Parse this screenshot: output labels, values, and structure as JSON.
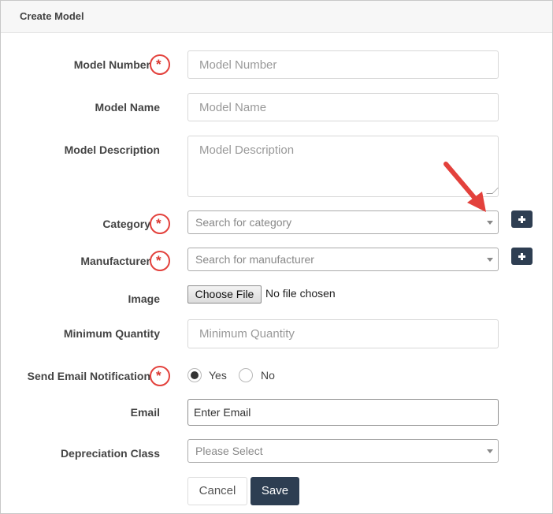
{
  "header": {
    "title": "Create Model"
  },
  "fields": {
    "model_number": {
      "label": "Model Number",
      "required": "*",
      "placeholder": "Model Number"
    },
    "model_name": {
      "label": "Model Name",
      "placeholder": "Model Name"
    },
    "model_description": {
      "label": "Model Description",
      "placeholder": "Model Description"
    },
    "category": {
      "label": "Category",
      "required": "*",
      "placeholder": "Search for category"
    },
    "manufacturer": {
      "label": "Manufacturer",
      "required": "*",
      "placeholder": "Search for manufacturer"
    },
    "image": {
      "label": "Image",
      "button": "Choose File",
      "status": "No file chosen"
    },
    "minimum_quantity": {
      "label": "Minimum Quantity",
      "placeholder": "Minimum Quantity"
    },
    "send_email": {
      "label": "Send Email Notification",
      "required": "*",
      "option_yes": "Yes",
      "option_no": "No",
      "selected": "Yes"
    },
    "email": {
      "label": "Email",
      "value": "Enter Email"
    },
    "depreciation_class": {
      "label": "Depreciation Class",
      "placeholder": "Please Select"
    }
  },
  "actions": {
    "cancel": "Cancel",
    "save": "Save"
  },
  "icons": {
    "add_category": "plus-icon",
    "add_manufacturer": "plus-icon",
    "annotation": "red-arrow-icon"
  },
  "colors": {
    "primary": "#2d3e52",
    "required": "#d9372f",
    "annotation": "#e3413c"
  }
}
